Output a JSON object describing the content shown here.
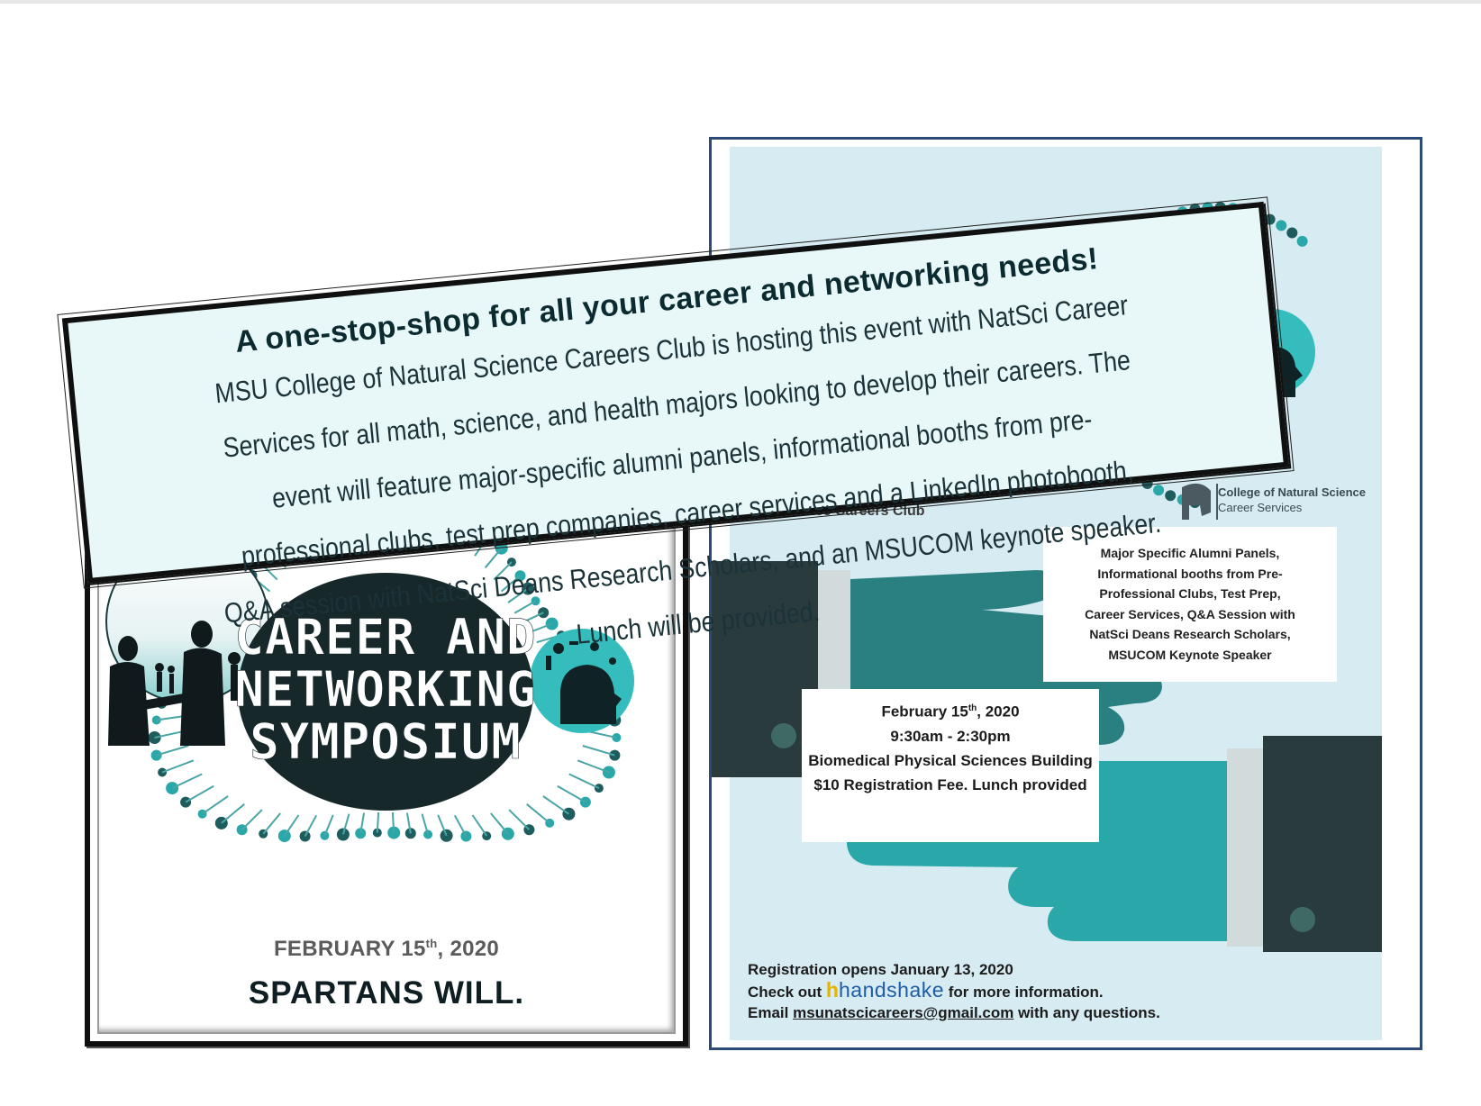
{
  "banner": {
    "heading": "A one-stop-shop for all your career and networking needs!",
    "lines": [
      "MSU College of Natural Science Careers Club is hosting this event with NatSci Career",
      "Services for all math, science, and health majors looking to develop their careers. The",
      "event will feature major-specific alumni panels, informational booths from pre-",
      "professional clubs, test prep companies, career services and a LinkedIn photobooth,",
      "Q&A session with NatSci Deans Research Scholars, and an MSUCOM keynote speaker.",
      "Lunch will be provided."
    ]
  },
  "left_poster": {
    "title_lines": [
      "CAREER AND",
      "NETWORKING",
      "SYMPOSIUM"
    ],
    "date_prefix": "FEBRUARY 15",
    "date_sup": "th",
    "date_suffix": ", 2020",
    "slogan": "SPARTANS WILL."
  },
  "right_poster": {
    "club_name": "Science Careers Club",
    "college_name": "College of Natural Science",
    "college_sub": "Career Services",
    "features": [
      "Major Specific Alumni Panels,",
      "Informational booths from Pre-",
      "Professional Clubs, Test Prep,",
      "Career Services, Q&A Session with",
      "NatSci Deans Research Scholars,",
      "MSUCOM Keynote Speaker"
    ],
    "date_prefix": "February 15",
    "date_sup": "th",
    "date_suffix": ", 2020",
    "time": "9:30am - 2:30pm",
    "location": "Biomedical Physical Sciences Building",
    "fee": "$10 Registration Fee. Lunch provided",
    "registration": "Registration opens January 13, 2020",
    "check_out": "Check out",
    "handshake_mark": "h",
    "handshake_word": "handshake",
    "more_info": "for more information.",
    "email_prefix": "Email",
    "email": "msunatscicareers@gmail.com",
    "email_suffix": "with any questions."
  },
  "colors": {
    "teal": "#2aa7a8",
    "dark_teal": "#1a3a3c",
    "banner_bg": "#e8f8f9",
    "panel_bg": "#d6ebf2",
    "navy_border": "#2c4a78"
  }
}
